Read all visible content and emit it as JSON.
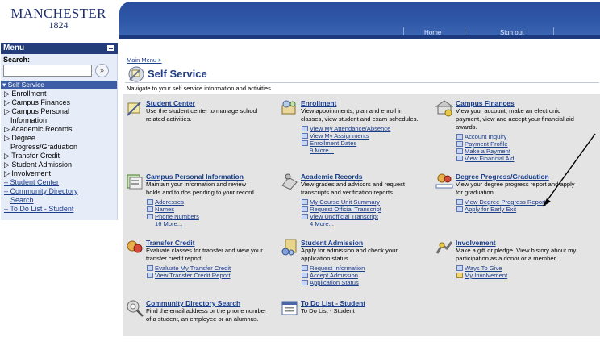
{
  "logo": {
    "line1": "MANCHESTER",
    "line2": "1824"
  },
  "header": {
    "home": "Home",
    "signout": "Sign out"
  },
  "menu": {
    "title": "Menu",
    "search_label": "Search:",
    "go": "»",
    "section": "▾ Self Service",
    "items": [
      "▷ Enrollment",
      "▷ Campus Finances",
      "▷ Campus Personal",
      "Information",
      "▷ Academic Records",
      "▷ Degree",
      "Progress/Graduation",
      "▷ Transfer Credit",
      "▷ Student Admission",
      "▷ Involvement"
    ],
    "links": [
      "– Student Center",
      "– Community Directory",
      "Search",
      "– To Do List - Student"
    ]
  },
  "content": {
    "breadcrumb": "Main Menu >",
    "title": "Self Service",
    "intro": "Navigate to your self service information and activities."
  },
  "tiles": [
    {
      "title": "Student Center",
      "desc": [
        "Use the student center to manage school",
        "related activities."
      ],
      "links": [],
      "more": ""
    },
    {
      "title": "Enrollment",
      "desc": [
        "View appointments, plan and enroll in",
        "classes, view student and exam schedules."
      ],
      "links": [
        "View My Attendance/Absence",
        "View My Assignments",
        "Enrollment Dates"
      ],
      "more": "9 More..."
    },
    {
      "title": "Campus Finances",
      "desc": [
        "View your account, make an electronic",
        "payment, view and accept your financial aid",
        "awards."
      ],
      "links": [
        "Account Inquiry",
        "Payment Profile",
        "Make a Payment",
        "View Financial Aid"
      ],
      "more": ""
    },
    {
      "title": "Campus Personal Information",
      "desc": [
        "Maintain your information and review",
        "holds and to dos pending to your record."
      ],
      "links": [
        "Addresses",
        "Names",
        "Phone Numbers"
      ],
      "more": "16 More..."
    },
    {
      "title": "Academic Records",
      "desc": [
        "View grades and advisors and request",
        "transcripts and verification reports."
      ],
      "links": [
        "My Course Unit Summary",
        "Request Official Transcript",
        "View Unofficial Transcript"
      ],
      "more": "4 More..."
    },
    {
      "title": "Degree Progress/Graduation",
      "desc": [
        "View your degree progress report and apply",
        "for graduation."
      ],
      "links": [
        "View Degree Progress Report",
        "Apply for Early Exit"
      ],
      "more": ""
    },
    {
      "title": "Transfer Credit",
      "desc": [
        "Evaluate classes for transfer and view your",
        "transfer credit report."
      ],
      "links": [
        "Evaluate My Transfer Credit",
        "View Transfer Credit Report"
      ],
      "more": ""
    },
    {
      "title": "Student Admission",
      "desc": [
        "Apply for admission and check your",
        "application status."
      ],
      "links": [
        "Request Information",
        "Accept Admission",
        "Application Status"
      ],
      "more": ""
    },
    {
      "title": "Involvement",
      "desc": [
        "Make a gift or pledge. View history about my",
        "participation as a donor or a member."
      ],
      "links": [
        "Ways To Give",
        "My Involvement"
      ],
      "more": ""
    },
    {
      "title": "Community Directory Search",
      "desc": [
        "Find the email address or the phone number",
        "of a student, an employee or an alumnus."
      ],
      "links": [],
      "more": ""
    },
    {
      "title": "To Do List - Student",
      "desc": [
        "To Do List - Student"
      ],
      "links": [],
      "more": ""
    }
  ]
}
